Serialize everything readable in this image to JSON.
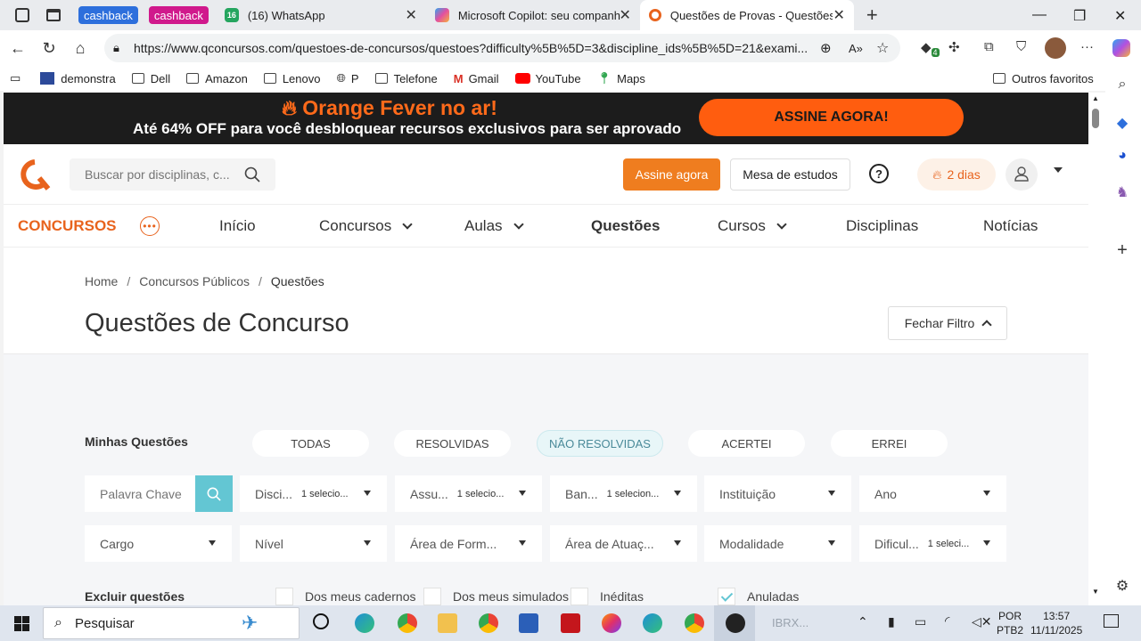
{
  "browser": {
    "tabs": [
      {
        "label": "(16) WhatsApp",
        "badge": "16"
      },
      {
        "label": "Microsoft Copilot: seu companhei"
      },
      {
        "label": "Questões de Provas - Questões d"
      }
    ],
    "cashback_labels": [
      "cashback",
      "cashback"
    ],
    "url": "https://www.qconcursos.com/questoes-de-concursos/questoes?difficulty%5B%5D=3&discipline_ids%5B%5D=21&exami...",
    "extension_badge": "4",
    "bookmarks": [
      "demonstra",
      "Dell",
      "Amazon",
      "Lenovo",
      "P",
      "Telefone",
      "Gmail",
      "YouTube",
      "Maps"
    ],
    "other_bookmarks": "Outros favoritos"
  },
  "promo": {
    "title": "Orange Fever no ar!",
    "subtitle": "Até 64% OFF para você desbloquear recursos exclusivos para ser aprovado",
    "cta": "ASSINE AGORA!"
  },
  "header": {
    "search_placeholder": "Buscar por disciplinas, c...",
    "subscribe": "Assine agora",
    "desk": "Mesa de estudos",
    "streak": "2 dias"
  },
  "menu": {
    "section": "CONCURSOS",
    "items": [
      "Início",
      "Concursos",
      "Aulas",
      "Questões",
      "Cursos",
      "Disciplinas",
      "Notícias"
    ]
  },
  "breadcrumb": [
    "Home",
    "Concursos Públicos",
    "Questões"
  ],
  "page_title": "Questões de Concurso",
  "filter_toggle": "Fechar Filtro",
  "filters": {
    "my_questions_label": "Minhas Questões",
    "pills": [
      "TODAS",
      "RESOLVIDAS",
      "NÃO RESOLVIDAS",
      "ACERTEI",
      "ERREI"
    ],
    "active_pill": "NÃO RESOLVIDAS",
    "keyword_placeholder": "Palavra Chave",
    "row1": [
      {
        "label": "Disci...",
        "selected": "1 selecio..."
      },
      {
        "label": "Assu...",
        "selected": "1 selecio..."
      },
      {
        "label": "Ban...",
        "selected": "1 selecion..."
      },
      {
        "label": "Instituição",
        "selected": ""
      },
      {
        "label": "Ano",
        "selected": ""
      }
    ],
    "row2": [
      {
        "label": "Cargo",
        "selected": ""
      },
      {
        "label": "Nível",
        "selected": ""
      },
      {
        "label": "Área de Form...",
        "selected": ""
      },
      {
        "label": "Área de Atuaç...",
        "selected": ""
      },
      {
        "label": "Modalidade",
        "selected": ""
      },
      {
        "label": "Dificul...",
        "selected": "1 seleci..."
      }
    ],
    "exclude_label": "Excluir questões",
    "exclude_options": [
      {
        "label": "Dos meus cadernos",
        "checked": false
      },
      {
        "label": "Dos meus simulados",
        "checked": false
      },
      {
        "label": "Inéditas",
        "checked": false
      },
      {
        "label": "Anuladas",
        "checked": true
      }
    ]
  },
  "taskbar": {
    "search": "Pesquisar",
    "ticker": "IBRX...",
    "lang": "POR",
    "layout": "PTB2",
    "time": "13:57",
    "date": "11/11/2025"
  },
  "colors": {
    "brand_orange": "#ef7d1f",
    "promo_bg": "#1c1c1c",
    "accent_teal": "#63c6d3"
  }
}
